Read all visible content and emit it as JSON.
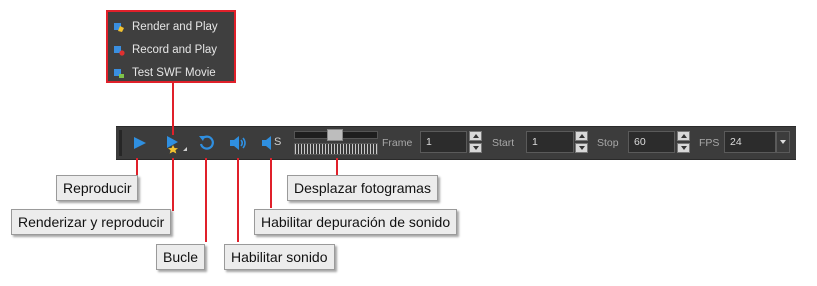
{
  "menu": {
    "items": [
      {
        "label": "Render and Play",
        "icon": "render-play-icon"
      },
      {
        "label": "Record and Play",
        "icon": "record-play-icon"
      },
      {
        "label": "Test SWF Movie",
        "icon": "swf-movie-icon"
      }
    ]
  },
  "toolbar": {
    "icons": {
      "play": "play-icon",
      "render_play": "render-and-play-icon",
      "loop": "loop-icon",
      "sound": "speaker-icon",
      "sound_scrub": "speaker-scrub-icon",
      "sound_scrub_letter": "S"
    },
    "frame": {
      "label": "Frame",
      "value": "1"
    },
    "start": {
      "label": "Start",
      "value": "1"
    },
    "stop": {
      "label": "Stop",
      "value": "60"
    },
    "fps": {
      "label": "FPS",
      "value": "24"
    }
  },
  "callouts": {
    "play": "Reproducir",
    "render_play": "Renderizar y reproducir",
    "loop": "Bucle",
    "sound": "Habilitar sonido",
    "sound_scrub": "Habilitar depuración de sonido",
    "frame_scrub": "Desplazar fotogramas"
  },
  "colors": {
    "accent_blue": "#2f8fe0",
    "callout_line": "#e0202a"
  }
}
